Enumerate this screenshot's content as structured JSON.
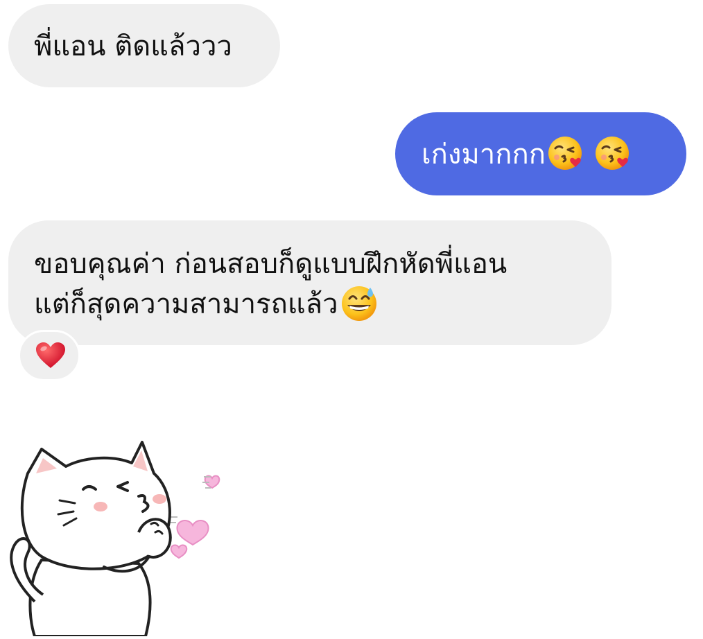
{
  "messages": [
    {
      "direction": "incoming",
      "text": "พี่แอน ติดแล้ววว",
      "bubble_color": "#efefef"
    },
    {
      "direction": "outgoing",
      "text": "เก่งมากกก",
      "emojis": [
        "kissing-face-with-heart-emoji",
        "kissing-face-with-heart-emoji"
      ],
      "bubble_color": "#4f6ae3"
    },
    {
      "direction": "incoming",
      "lines": [
        "ขอบคุณค่า ก่อนสอบก็ดูแบบฝึกหัดพี่แอน",
        "แต่ก็สุดความสามารถแล้ว"
      ],
      "emojis": [
        "grinning-face-with-sweat-emoji"
      ],
      "reaction": "red-heart-emoji",
      "bubble_color": "#efefef"
    },
    {
      "direction": "incoming",
      "type": "sticker",
      "sticker": "white-cat-blowing-kiss-sticker"
    }
  ]
}
